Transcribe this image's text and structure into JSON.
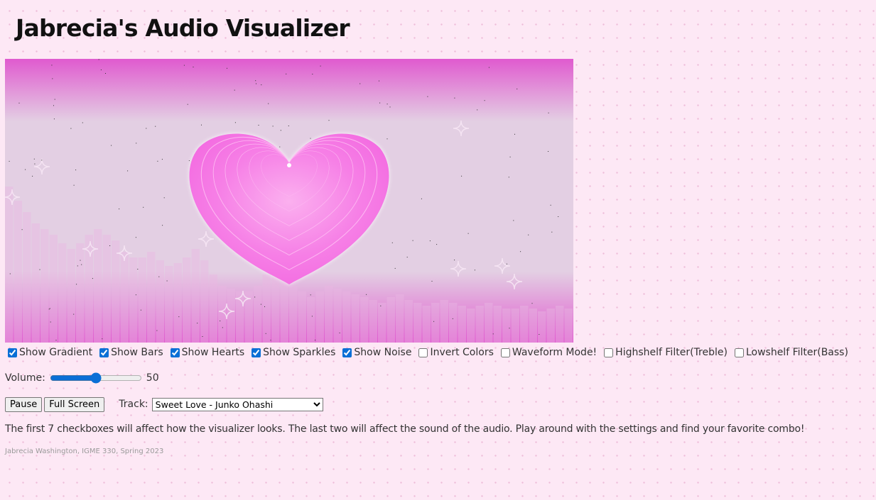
{
  "page": {
    "title": "Jabrecia's Audio Visualizer"
  },
  "visualizer": {
    "colors": {
      "gradient_top": "#e05acf",
      "gradient_mid": "#e3cfe3",
      "heart": "#f77ee8",
      "heart_glow": "#ffffff",
      "bars": "#e8b6e2"
    },
    "bar_levels": [
      0.55,
      0.5,
      0.46,
      0.42,
      0.4,
      0.38,
      0.35,
      0.33,
      0.35,
      0.38,
      0.4,
      0.38,
      0.36,
      0.32,
      0.3,
      0.3,
      0.32,
      0.29,
      0.27,
      0.28,
      0.3,
      0.33,
      0.29,
      0.24,
      0.2,
      0.19,
      0.18,
      0.18,
      0.2,
      0.24,
      0.23,
      0.21,
      0.2,
      0.18,
      0.16,
      0.18,
      0.2,
      0.19,
      0.18,
      0.17,
      0.16,
      0.15,
      0.14,
      0.16,
      0.17,
      0.15,
      0.14,
      0.13,
      0.14,
      0.15,
      0.14,
      0.13,
      0.12,
      0.13,
      0.14,
      0.13,
      0.12,
      0.12,
      0.13,
      0.12,
      0.11,
      0.12,
      0.13,
      0.12
    ]
  },
  "controls": {
    "checkboxes": [
      {
        "label": "Show Gradient",
        "checked": true
      },
      {
        "label": "Show Bars",
        "checked": true
      },
      {
        "label": "Show Hearts",
        "checked": true
      },
      {
        "label": "Show Sparkles",
        "checked": true
      },
      {
        "label": "Show Noise",
        "checked": true
      },
      {
        "label": "Invert Colors",
        "checked": false
      },
      {
        "label": "Waveform Mode!",
        "checked": false
      },
      {
        "label": "Highshelf Filter(Treble)",
        "checked": false
      },
      {
        "label": "Lowshelf Filter(Bass)",
        "checked": false
      }
    ],
    "volume": {
      "label": "Volume:",
      "value": 50,
      "value_text": "50"
    },
    "pause_label": "Pause",
    "fullscreen_label": "Full Screen",
    "track": {
      "label": "Track:",
      "selected": "Sweet Love - Junko Ohashi"
    }
  },
  "instructions": "The first 7 checkboxes will affect how the visualizer looks. The last two will affect the sound of the audio. Play around with the settings and find your favorite combo!",
  "footer": "Jabrecia Washington, IGME 330, Spring 2023"
}
